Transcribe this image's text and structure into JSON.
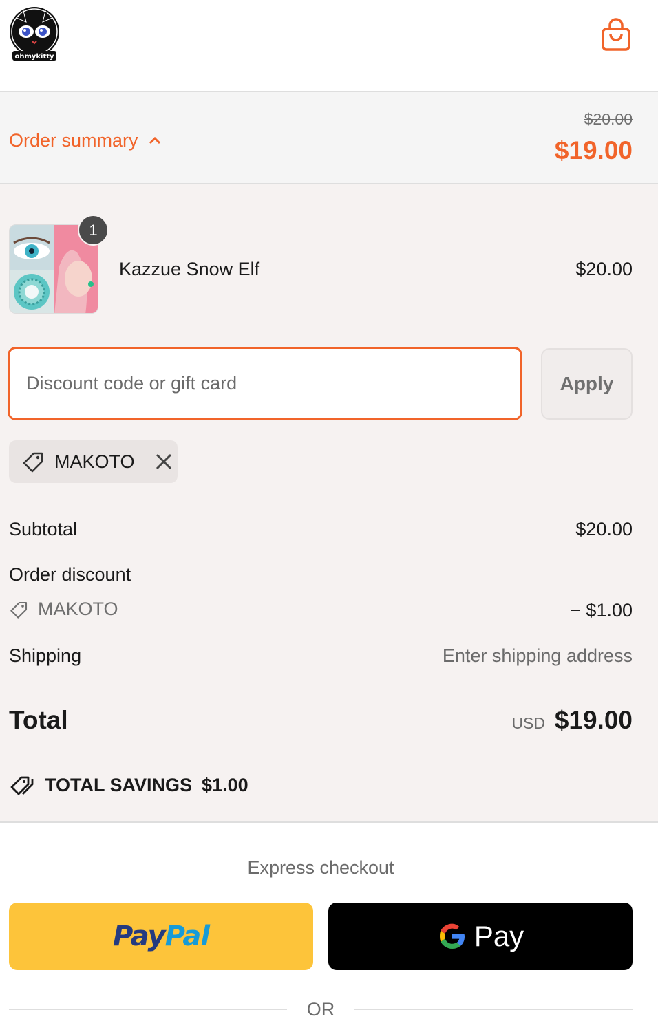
{
  "header": {
    "logo_text": "ohmykitty",
    "cart_icon": "shopping-bag-icon"
  },
  "summary": {
    "toggle_label": "Order summary",
    "original_total": "$20.00",
    "total": "$19.00",
    "chevron_icon": "chevron-up-icon"
  },
  "product": {
    "name": "Kazzue Snow Elf",
    "price": "$20.00",
    "quantity": "1"
  },
  "discount": {
    "placeholder": "Discount code or gift card",
    "apply_label": "Apply",
    "applied_code": "MAKOTO",
    "tag_icon": "tag-icon",
    "remove_icon": "close-icon"
  },
  "totals": {
    "subtotal_label": "Subtotal",
    "subtotal_value": "$20.00",
    "order_discount_label": "Order discount",
    "discount_code": "MAKOTO",
    "discount_value": "− $1.00",
    "shipping_label": "Shipping",
    "shipping_value": "Enter shipping address",
    "total_label": "Total",
    "total_currency": "USD",
    "total_value": "$19.00",
    "savings_label": "TOTAL SAVINGS",
    "savings_value": "$1.00"
  },
  "express": {
    "title": "Express checkout",
    "paypal_pay": "Pay",
    "paypal_pal": "Pal",
    "gpay_label": "Pay",
    "or_label": "OR"
  },
  "colors": {
    "accent": "#f1642a",
    "panel_bg": "#f6f2f1",
    "paypal_yellow": "#fdc43a",
    "paypal_dark_blue": "#253b80",
    "paypal_light_blue": "#179bd7"
  }
}
